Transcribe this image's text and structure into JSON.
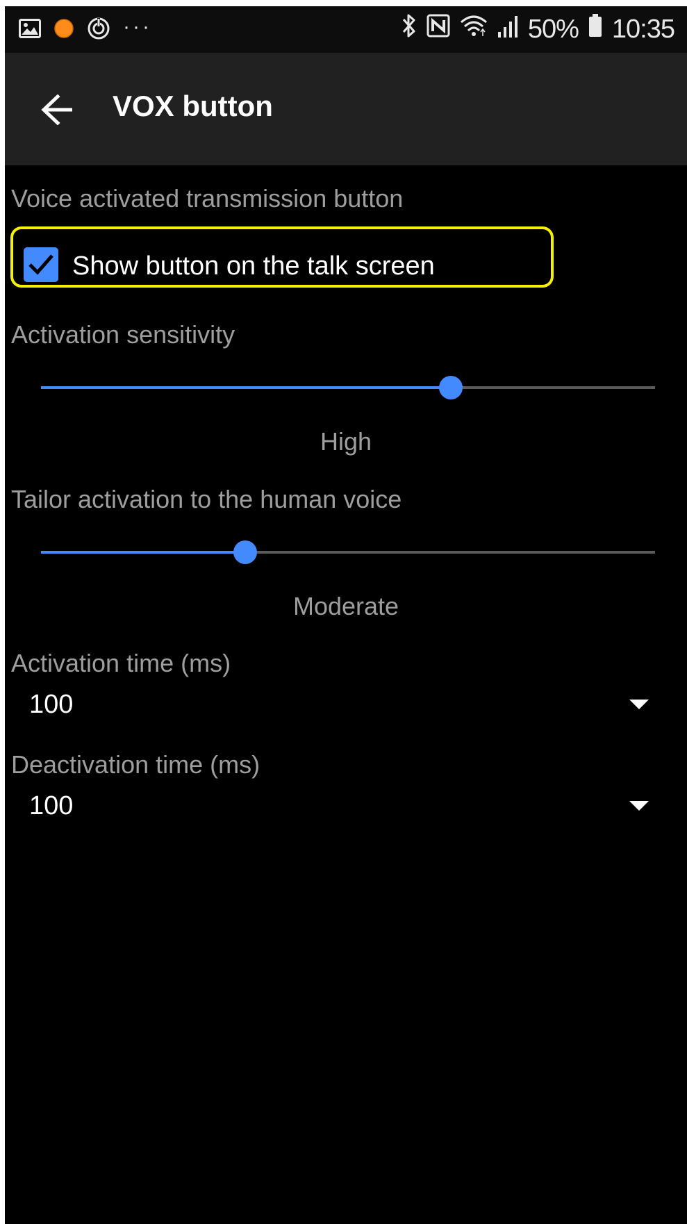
{
  "status_bar": {
    "left_icons": [
      "gallery-icon",
      "orange-dot-icon",
      "sync-icon",
      "more-dots-icon"
    ],
    "more_dots": "···",
    "right_icons": [
      "bluetooth-icon",
      "nfc-icon",
      "wifi-icon",
      "signal-icon",
      "battery-icon"
    ],
    "battery_percent": "50%",
    "time": "10:35",
    "colors": {
      "orange_dot": "#ff8c1a"
    }
  },
  "app_bar": {
    "back_icon": "arrow-back-icon",
    "title": "VOX button"
  },
  "sections": {
    "vox_button": {
      "heading": "Voice activated transmission button",
      "checkbox_label": "Show button on the talk screen",
      "checked": true
    },
    "sensitivity": {
      "heading": "Activation sensitivity",
      "value_fraction": 0.667,
      "value_label": "High"
    },
    "human_voice": {
      "heading": "Tailor activation to the human voice",
      "value_fraction": 0.333,
      "value_label": "Moderate"
    },
    "activation_time": {
      "heading": "Activation time (ms)",
      "value": "100"
    },
    "deactivation_time": {
      "heading": "Deactivation time (ms)",
      "value": "100"
    }
  },
  "colors": {
    "accent": "#448aff",
    "highlight": "#f5f00a",
    "background": "#000000",
    "app_bar": "#212121",
    "secondary_text": "#9e9e9e"
  }
}
